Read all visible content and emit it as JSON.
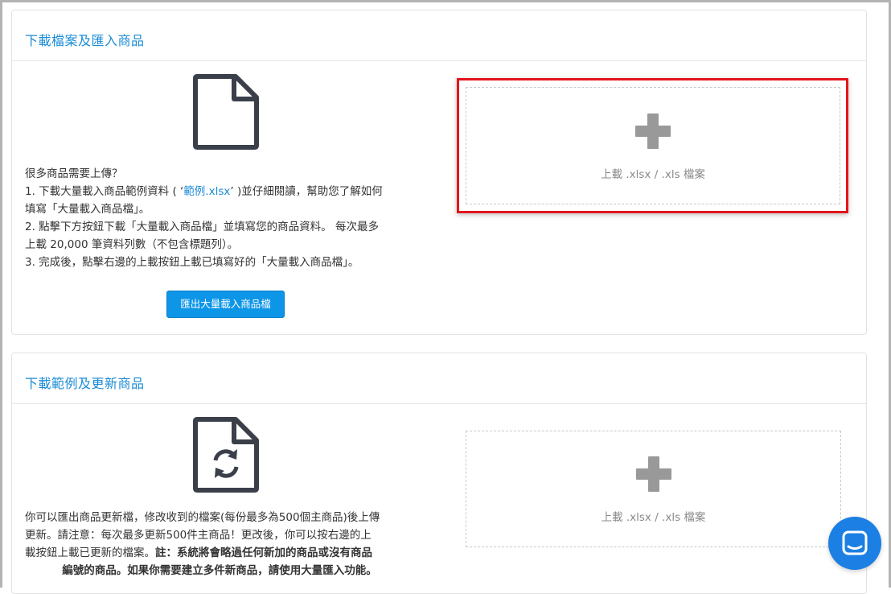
{
  "panel1": {
    "title": "下載檔案及匯入商品",
    "instructions": {
      "line0": "很多商品需要上傳？",
      "line1_pre": "1. 下載大量載入商品範例資料 ( ‘",
      "line1_link": "範例.xlsx",
      "line1_post": "’ )並仔細閱讀，幫助您了解如何",
      "line1_cont": "填寫「大量載入商品檔」。",
      "line2": "2. 點擊下方按鈕下載「大量載入商品檔」並填寫您的商品資料。 每次最多",
      "line2_cont": "上載 20,000 筆資料列數（不包含標題列）。",
      "line3": "3. 完成後，點擊右邊的上載按鈕上載已填寫好的「大量載入商品檔」。"
    },
    "export_button": "匯出大量載入商品檔",
    "dropzone_label": "上載 .xlsx / .xls 檔案"
  },
  "panel2": {
    "title": "下載範例及更新商品",
    "desc_line1": "你可以匯出商品更新檔，修改收到的檔案(每份最多為500個主商品)後上傳",
    "desc_line2": "更新。請注意：每次最多更新500件主商品！更改後，你可以按右邊的上",
    "desc_line3_pre": "載按鈕上載已更新的檔案。",
    "desc_line3_bold": "註：系統將會略過任何新加的商品或沒有商品",
    "desc_line4_bold": "編號的商品。如果你需要建立多件新商品，請使用大量匯入功能。",
    "dropzone_label": "上載 .xlsx / .xls 檔案"
  },
  "icons": {
    "file": "file-icon",
    "file_sync": "file-sync-icon",
    "plus": "plus-icon",
    "chat": "chat-icon"
  },
  "colors": {
    "accent": "#1a8bd6",
    "button": "#0d95e8",
    "highlight": "#e4151c",
    "chat": "#1c7fe3"
  }
}
